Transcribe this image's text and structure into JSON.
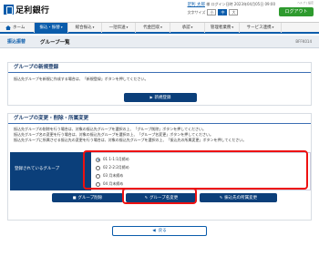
{
  "header": {
    "logo_text": "足利銀行",
    "user_prefix": "足利",
    "user_name": "太郎",
    "user_suffix": "様",
    "login_info": "ログイン日時 2023年04月05日 09:00",
    "font_size_label": "文字サイズ",
    "font_sizes": [
      "小",
      "中",
      "大"
    ],
    "logout_label": "ログアウト",
    "help_links": "ヘルプ | 設定"
  },
  "nav": {
    "items": [
      {
        "label": "ホーム"
      },
      {
        "label": "振込・振替"
      },
      {
        "label": "総合振込"
      },
      {
        "label": "一括伝送"
      },
      {
        "label": "代金回収"
      },
      {
        "label": "承認"
      },
      {
        "label": "管理者業務"
      },
      {
        "label": "サービス連携"
      }
    ]
  },
  "titlebar": {
    "breadcrumb": "振込振替",
    "title": "グループ一覧",
    "screen_id": "BFFK014"
  },
  "new_group": {
    "heading": "グループの新規登録",
    "description": "振込先グループを新規に作成する場合は、「新規登録」ボタンを押してください。",
    "button_label": "新規登録"
  },
  "edit_group": {
    "heading": "グループの変更・削除・所属変更",
    "desc1": "振込先グループの削除を行う場合は、対象の振込先グループを選択の上、「グループ削除」ボタンを押してください。",
    "desc2": "振込先グループ名の変更を行う場合は、対象の振込先グループを選択の上、「グループ名変更」ボタンを押してください。",
    "desc3": "振込先グループに所属させる振込先の変更を行う場合は、対象の振込先グループを選択の上、「振込先の所属変更」ボタンを押してください。",
    "group_label": "登録されているグループ",
    "options": [
      {
        "label": "01 1-1:1月締め"
      },
      {
        "label": "02 2-2:2月締め"
      },
      {
        "label": "03 月末締め"
      },
      {
        "label": "04 月末締め"
      }
    ],
    "buttons": {
      "delete": "グループ削除",
      "rename": "グループ名変更",
      "reassign": "振込先の所属変更"
    }
  },
  "footer": {
    "back_label": "戻る"
  },
  "colors": {
    "primary": "#0b3f7a",
    "accent": "#0a5cab",
    "logout": "#2e9a2e",
    "highlight": "#e11111"
  }
}
